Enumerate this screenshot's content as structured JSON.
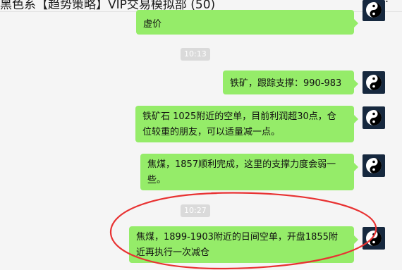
{
  "window": {
    "title": "黑色系【趋势策略】VIP交易模拟部 (50)",
    "more_icon": "ellipsis-icon",
    "more_label": "···"
  },
  "colors": {
    "background": "#f5f5f5",
    "bubble": "#95ec69",
    "time_badge": "#dadada",
    "avatar_bg": "#16283e",
    "annotation": "#e83232"
  },
  "messages": [
    {
      "type": "text",
      "text": "虚价",
      "from": "self",
      "avatar_icon": "yin-yang-icon"
    },
    {
      "type": "time",
      "text": "10:13"
    },
    {
      "type": "text",
      "text": "铁矿，跟踪支撑：990-983",
      "from": "self",
      "avatar_icon": "yin-yang-icon"
    },
    {
      "type": "text",
      "lines": [
        "铁矿石 1025附近的空单，目前利润超30点，仓",
        "位较重的朋友，可以适量减一点。"
      ],
      "from": "self",
      "avatar_icon": "yin-yang-icon"
    },
    {
      "type": "text",
      "lines": [
        "焦煤，1857顺利完成，这里的支撑力度会弱一",
        "些。"
      ],
      "from": "self",
      "avatar_icon": "yin-yang-icon"
    },
    {
      "type": "time",
      "text": "10:27"
    },
    {
      "type": "text",
      "lines": [
        "焦煤，1899-1903附近的日间空单，开盘1855附",
        "近再执行一次减仓"
      ],
      "from": "self",
      "avatar_icon": "yin-yang-icon",
      "highlighted": true
    }
  ]
}
